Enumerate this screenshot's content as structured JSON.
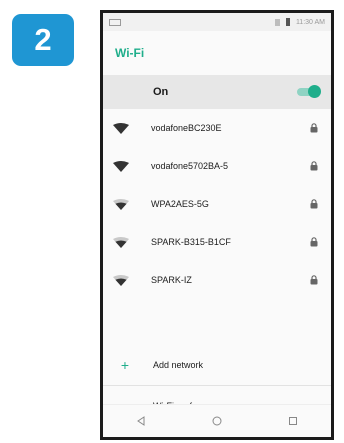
{
  "step": {
    "number": "2"
  },
  "status_bar": {
    "time": "11:30 AM"
  },
  "header": {
    "title": "Wi-Fi"
  },
  "wifi_toggle": {
    "label": "On",
    "state": true
  },
  "networks": [
    {
      "ssid": "vodafoneBC230E",
      "signal": "full",
      "secured": true
    },
    {
      "ssid": "vodafone5702BA-5",
      "signal": "full",
      "secured": true
    },
    {
      "ssid": "WPA2AES-5G",
      "signal": "strong",
      "secured": true
    },
    {
      "ssid": "SPARK-B315-B1CF",
      "signal": "strong",
      "secured": true
    },
    {
      "ssid": "SPARK-IZ",
      "signal": "strong",
      "secured": true
    }
  ],
  "actions": {
    "add_network": "Add network",
    "preferences": "Wi-Fi preferences"
  },
  "colors": {
    "accent": "#1fae8b",
    "badge": "#1f96d3"
  },
  "icons": {
    "network": "wifi-icon",
    "secured": "lock-icon",
    "add": "plus-icon",
    "nav": [
      "back-icon",
      "home-icon",
      "recents-icon"
    ]
  }
}
